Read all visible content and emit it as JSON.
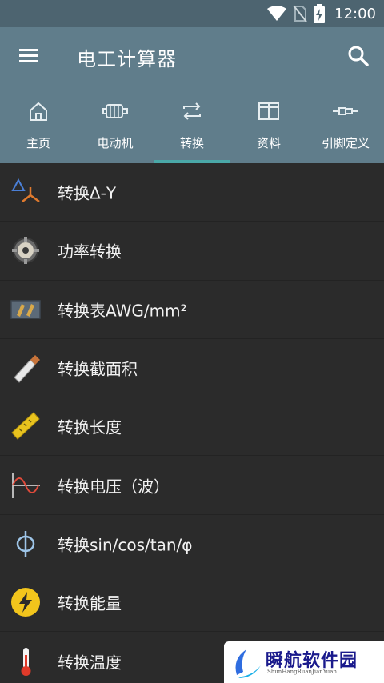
{
  "status_bar": {
    "time": "12:00",
    "icons": [
      "wifi-icon",
      "no-sim-icon",
      "battery-charging-icon"
    ]
  },
  "app_bar": {
    "title": "电工计算器",
    "menu_icon": "hamburger-menu-icon",
    "search_icon": "search-icon"
  },
  "tabs": [
    {
      "label": "主页",
      "icon": "home-icon",
      "active": false
    },
    {
      "label": "电动机",
      "icon": "motor-icon",
      "active": false
    },
    {
      "label": "转换",
      "icon": "swap-arrows-icon",
      "active": true
    },
    {
      "label": "资料",
      "icon": "book-icon",
      "active": false
    },
    {
      "label": "引脚定义",
      "icon": "connector-icon",
      "active": false
    }
  ],
  "items": [
    {
      "label": "转换Δ-Y",
      "icon": "delta-wye-icon"
    },
    {
      "label": "功率转换",
      "icon": "gear-motor-icon"
    },
    {
      "label": "转换表AWG/mm²",
      "icon": "awg-table-icon"
    },
    {
      "label": "转换截面积",
      "icon": "cable-cross-section-icon"
    },
    {
      "label": "转换长度",
      "icon": "ruler-icon"
    },
    {
      "label": "转换电压（波）",
      "icon": "sine-wave-icon"
    },
    {
      "label": "转换sin/cos/tan/φ",
      "icon": "phi-icon"
    },
    {
      "label": "转换能量",
      "icon": "lightning-icon"
    },
    {
      "label": "转换温度",
      "icon": "thermometer-icon"
    }
  ],
  "watermark": {
    "text": "瞬航软件园",
    "subtext": "ShunHangRuanJianYuan"
  },
  "colors": {
    "status_bar": "#4d6470",
    "app_bar": "#607d8b",
    "list_bg": "#2b2b2b",
    "tab_indicator": "#4aa8a8"
  }
}
